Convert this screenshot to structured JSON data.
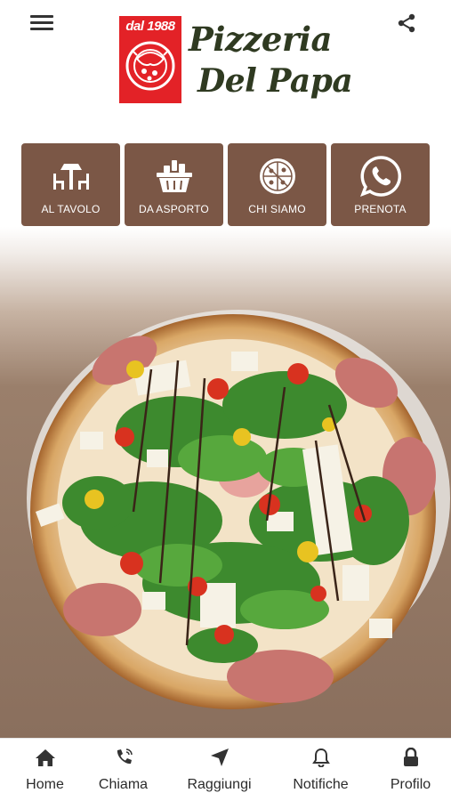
{
  "app": {
    "logo": {
      "since": "dal 1988",
      "name_line1": "Pizzeria",
      "name_line2": "Del Papa"
    },
    "colors": {
      "brand_red": "#e32227",
      "tile_brown": "#7b5746",
      "logo_text": "#2f3a21"
    }
  },
  "header": {
    "menu_icon": "hamburger-icon",
    "share_icon": "share-icon"
  },
  "tiles": [
    {
      "label": "AL TAVOLO",
      "icon": "table-chairs-icon"
    },
    {
      "label": "DA ASPORTO",
      "icon": "takeaway-basket-icon"
    },
    {
      "label": "CHI SIAMO",
      "icon": "pizza-icon"
    },
    {
      "label": "PRENOTA",
      "icon": "whatsapp-icon"
    }
  ],
  "bottom_nav": [
    {
      "label": "Home",
      "icon": "home-icon"
    },
    {
      "label": "Chiama",
      "icon": "phone-icon"
    },
    {
      "label": "Raggiungi",
      "icon": "location-arrow-icon"
    },
    {
      "label": "Notifiche",
      "icon": "bell-icon"
    },
    {
      "label": "Profilo",
      "icon": "lock-icon"
    }
  ]
}
